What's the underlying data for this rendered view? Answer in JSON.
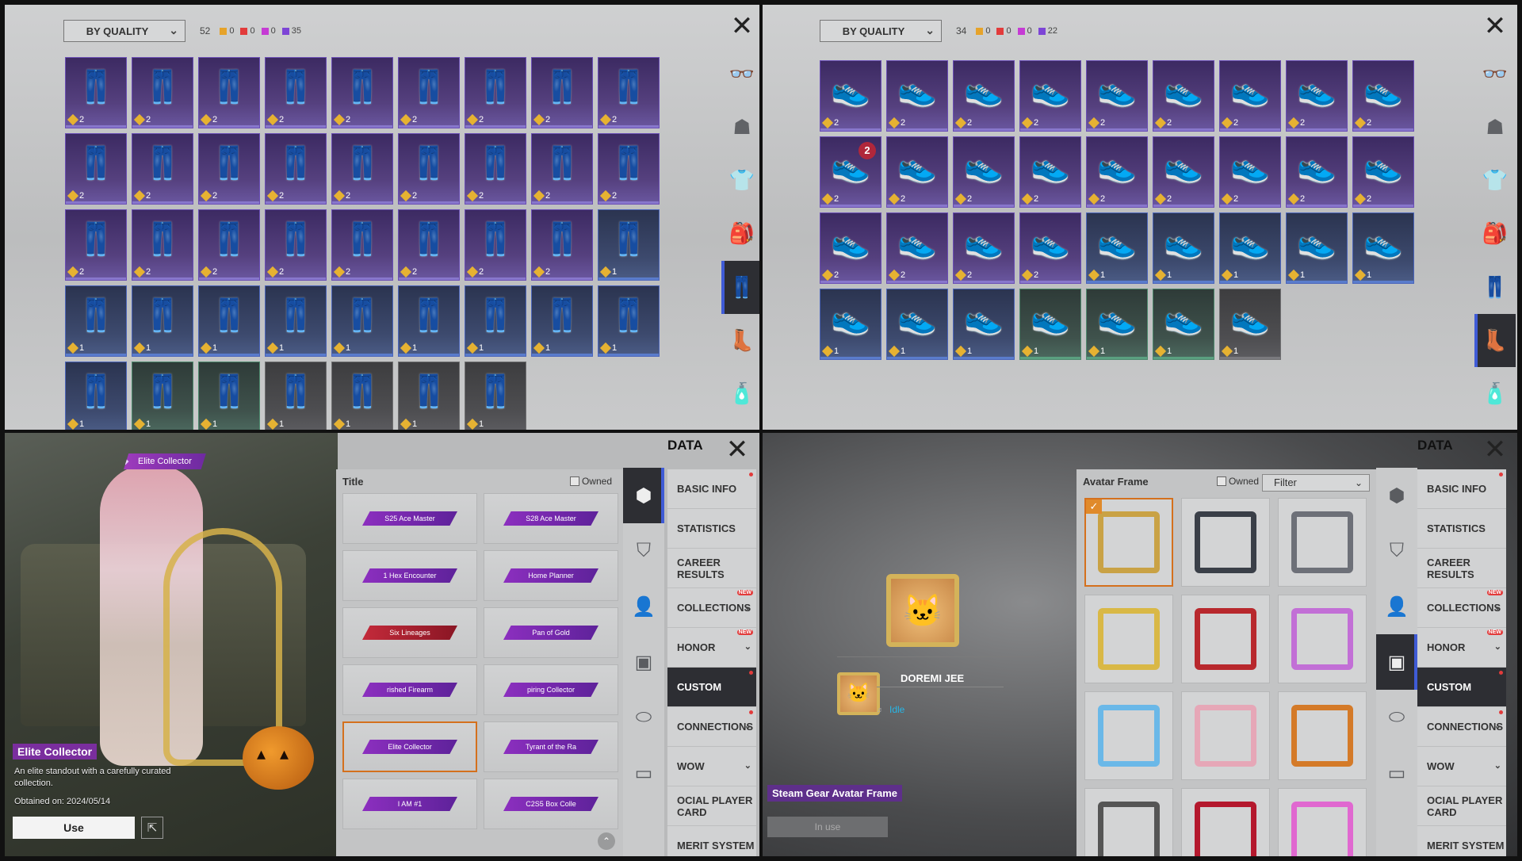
{
  "q1": {
    "sort_label": "BY QUALITY",
    "total": "52",
    "chips": [
      {
        "color": "#e6a32a",
        "value": "0"
      },
      {
        "color": "#e23b3b",
        "value": "0"
      },
      {
        "color": "#c53bd4",
        "value": "0"
      },
      {
        "color": "#7d45d6",
        "value": "35"
      }
    ],
    "items": [
      {
        "q": "purple",
        "n": "2"
      },
      {
        "q": "purple",
        "n": "2"
      },
      {
        "q": "purple",
        "n": "2"
      },
      {
        "q": "purple",
        "n": "2"
      },
      {
        "q": "purple",
        "n": "2"
      },
      {
        "q": "purple",
        "n": "2"
      },
      {
        "q": "purple",
        "n": "2"
      },
      {
        "q": "purple",
        "n": "2"
      },
      {
        "q": "purple",
        "n": "2"
      },
      {
        "q": "purple",
        "n": "2"
      },
      {
        "q": "purple",
        "n": "2"
      },
      {
        "q": "purple",
        "n": "2"
      },
      {
        "q": "purple",
        "n": "2"
      },
      {
        "q": "purple",
        "n": "2"
      },
      {
        "q": "purple",
        "n": "2"
      },
      {
        "q": "purple",
        "n": "2"
      },
      {
        "q": "purple",
        "n": "2"
      },
      {
        "q": "purple",
        "n": "2"
      },
      {
        "q": "purple",
        "n": "2"
      },
      {
        "q": "purple",
        "n": "2"
      },
      {
        "q": "purple",
        "n": "2"
      },
      {
        "q": "purple",
        "n": "2"
      },
      {
        "q": "purple",
        "n": "2"
      },
      {
        "q": "purple",
        "n": "2"
      },
      {
        "q": "purple",
        "n": "2"
      },
      {
        "q": "purple",
        "n": "2"
      },
      {
        "q": "blue",
        "n": "1"
      },
      {
        "q": "blue",
        "n": "1"
      },
      {
        "q": "blue",
        "n": "1"
      },
      {
        "q": "blue",
        "n": "1"
      },
      {
        "q": "blue",
        "n": "1"
      },
      {
        "q": "blue",
        "n": "1"
      },
      {
        "q": "blue",
        "n": "1"
      },
      {
        "q": "blue",
        "n": "1"
      },
      {
        "q": "blue",
        "n": "1"
      },
      {
        "q": "blue",
        "n": "1"
      },
      {
        "q": "blue",
        "n": "1"
      },
      {
        "q": "green",
        "n": "1"
      },
      {
        "q": "green",
        "n": "1"
      },
      {
        "q": "gray",
        "n": "1"
      },
      {
        "q": "gray",
        "n": "1"
      },
      {
        "q": "gray",
        "n": "1"
      },
      {
        "q": "gray",
        "n": "1"
      }
    ],
    "rail_icons": [
      "glasses-icon",
      "mask-icon",
      "jacket-icon",
      "backpack-icon",
      "pants-icon",
      "boots-icon",
      "bottle-icon"
    ],
    "rail_active": 4
  },
  "q2": {
    "sort_label": "BY QUALITY",
    "total": "34",
    "chips": [
      {
        "color": "#e6a32a",
        "value": "0"
      },
      {
        "color": "#e23b3b",
        "value": "0"
      },
      {
        "color": "#c53bd4",
        "value": "0"
      },
      {
        "color": "#7d45d6",
        "value": "22"
      }
    ],
    "items": [
      {
        "q": "purple",
        "n": "2"
      },
      {
        "q": "purple",
        "n": "2"
      },
      {
        "q": "purple",
        "n": "2"
      },
      {
        "q": "purple",
        "n": "2"
      },
      {
        "q": "purple",
        "n": "2"
      },
      {
        "q": "purple",
        "n": "2"
      },
      {
        "q": "purple",
        "n": "2"
      },
      {
        "q": "purple",
        "n": "2"
      },
      {
        "q": "purple",
        "n": "2"
      },
      {
        "q": "purple",
        "n": "2",
        "badge": "2"
      },
      {
        "q": "purple",
        "n": "2"
      },
      {
        "q": "purple",
        "n": "2"
      },
      {
        "q": "purple",
        "n": "2"
      },
      {
        "q": "purple",
        "n": "2"
      },
      {
        "q": "purple",
        "n": "2"
      },
      {
        "q": "purple",
        "n": "2"
      },
      {
        "q": "purple",
        "n": "2"
      },
      {
        "q": "purple",
        "n": "2"
      },
      {
        "q": "purple",
        "n": "2"
      },
      {
        "q": "purple",
        "n": "2"
      },
      {
        "q": "purple",
        "n": "2"
      },
      {
        "q": "purple",
        "n": "2"
      },
      {
        "q": "blue",
        "n": "1"
      },
      {
        "q": "blue",
        "n": "1"
      },
      {
        "q": "blue",
        "n": "1"
      },
      {
        "q": "blue",
        "n": "1"
      },
      {
        "q": "blue",
        "n": "1"
      },
      {
        "q": "blue",
        "n": "1"
      },
      {
        "q": "blue",
        "n": "1"
      },
      {
        "q": "blue",
        "n": "1"
      },
      {
        "q": "green",
        "n": "1"
      },
      {
        "q": "green",
        "n": "1"
      },
      {
        "q": "green",
        "n": "1"
      },
      {
        "q": "gray",
        "n": "1"
      }
    ],
    "rail_icons": [
      "glasses-icon",
      "mask-icon",
      "jacket-icon",
      "backpack-icon",
      "pants-icon",
      "boots-icon",
      "bottle-icon"
    ],
    "rail_active": 5
  },
  "q3": {
    "char_title": "Elite Collector",
    "name": "Elite Collector",
    "desc": "An elite standout with a carefully curated collection.",
    "obtained": "Obtained on: 2024/05/14",
    "use_label": "Use",
    "panel_title": "Title",
    "owned_label": "Owned",
    "data_title": "DATA",
    "titles": [
      {
        "label": "S25 Ace Master",
        "style": "purple"
      },
      {
        "label": "S28 Ace Master",
        "style": "purple"
      },
      {
        "label": "1 Hex Encounter",
        "style": "purple"
      },
      {
        "label": "Home Planner",
        "style": "purple"
      },
      {
        "label": "Six Lineages",
        "style": "red"
      },
      {
        "label": "Pan of Gold",
        "style": "purple"
      },
      {
        "label": "rished Firearm",
        "style": "purple"
      },
      {
        "label": "piring Collector",
        "style": "purple"
      },
      {
        "label": "Elite Collector",
        "style": "purple",
        "sel": true
      },
      {
        "label": "Tyrant of the Ra",
        "style": "purple"
      },
      {
        "label": "I AM #1",
        "style": "purple"
      },
      {
        "label": "C2S5 Box Colle",
        "style": "purple"
      }
    ]
  },
  "q4": {
    "panel_title": "Avatar Frame",
    "owned_label": "Owned",
    "filter_label": "Filter",
    "data_title": "DATA",
    "player_name": "DOREMI JEE",
    "status": "Idle",
    "frame_label": "Steam Gear Avatar Frame",
    "inuse_label": "In use",
    "frames": [
      {
        "color": "#c9a245",
        "sel": true
      },
      {
        "color": "#3a3f48"
      },
      {
        "color": "#6d7078"
      },
      {
        "color": "#d9b846"
      },
      {
        "color": "#b8282d"
      },
      {
        "color": "#c26fd6"
      },
      {
        "color": "#6ab8e8"
      },
      {
        "color": "#e6a7b7"
      },
      {
        "color": "#d47a28"
      },
      {
        "color": "#555"
      },
      {
        "color": "#b4182d"
      },
      {
        "color": "#e068d0"
      }
    ]
  },
  "menu": [
    {
      "label": "BASIC INFO",
      "dot": true
    },
    {
      "label": "STATISTICS"
    },
    {
      "label": "CAREER RESULTS"
    },
    {
      "label": "COLLECTIONS",
      "new": "NEW",
      "chev": true
    },
    {
      "label": "HONOR",
      "new": "NEW",
      "chev": true
    },
    {
      "label": "CUSTOM",
      "dot": true,
      "active": true
    },
    {
      "label": "CONNECTIONS",
      "dot": true,
      "chev": true
    },
    {
      "label": "WOW",
      "chev": true
    },
    {
      "label": "OCIAL PLAYER CARD"
    },
    {
      "label": "MERIT SYSTEM"
    }
  ],
  "side_icons": [
    "shield-icon",
    "banner-icon",
    "person-icon",
    "frame-icon",
    "toggle-icon",
    "nameplate-icon"
  ]
}
